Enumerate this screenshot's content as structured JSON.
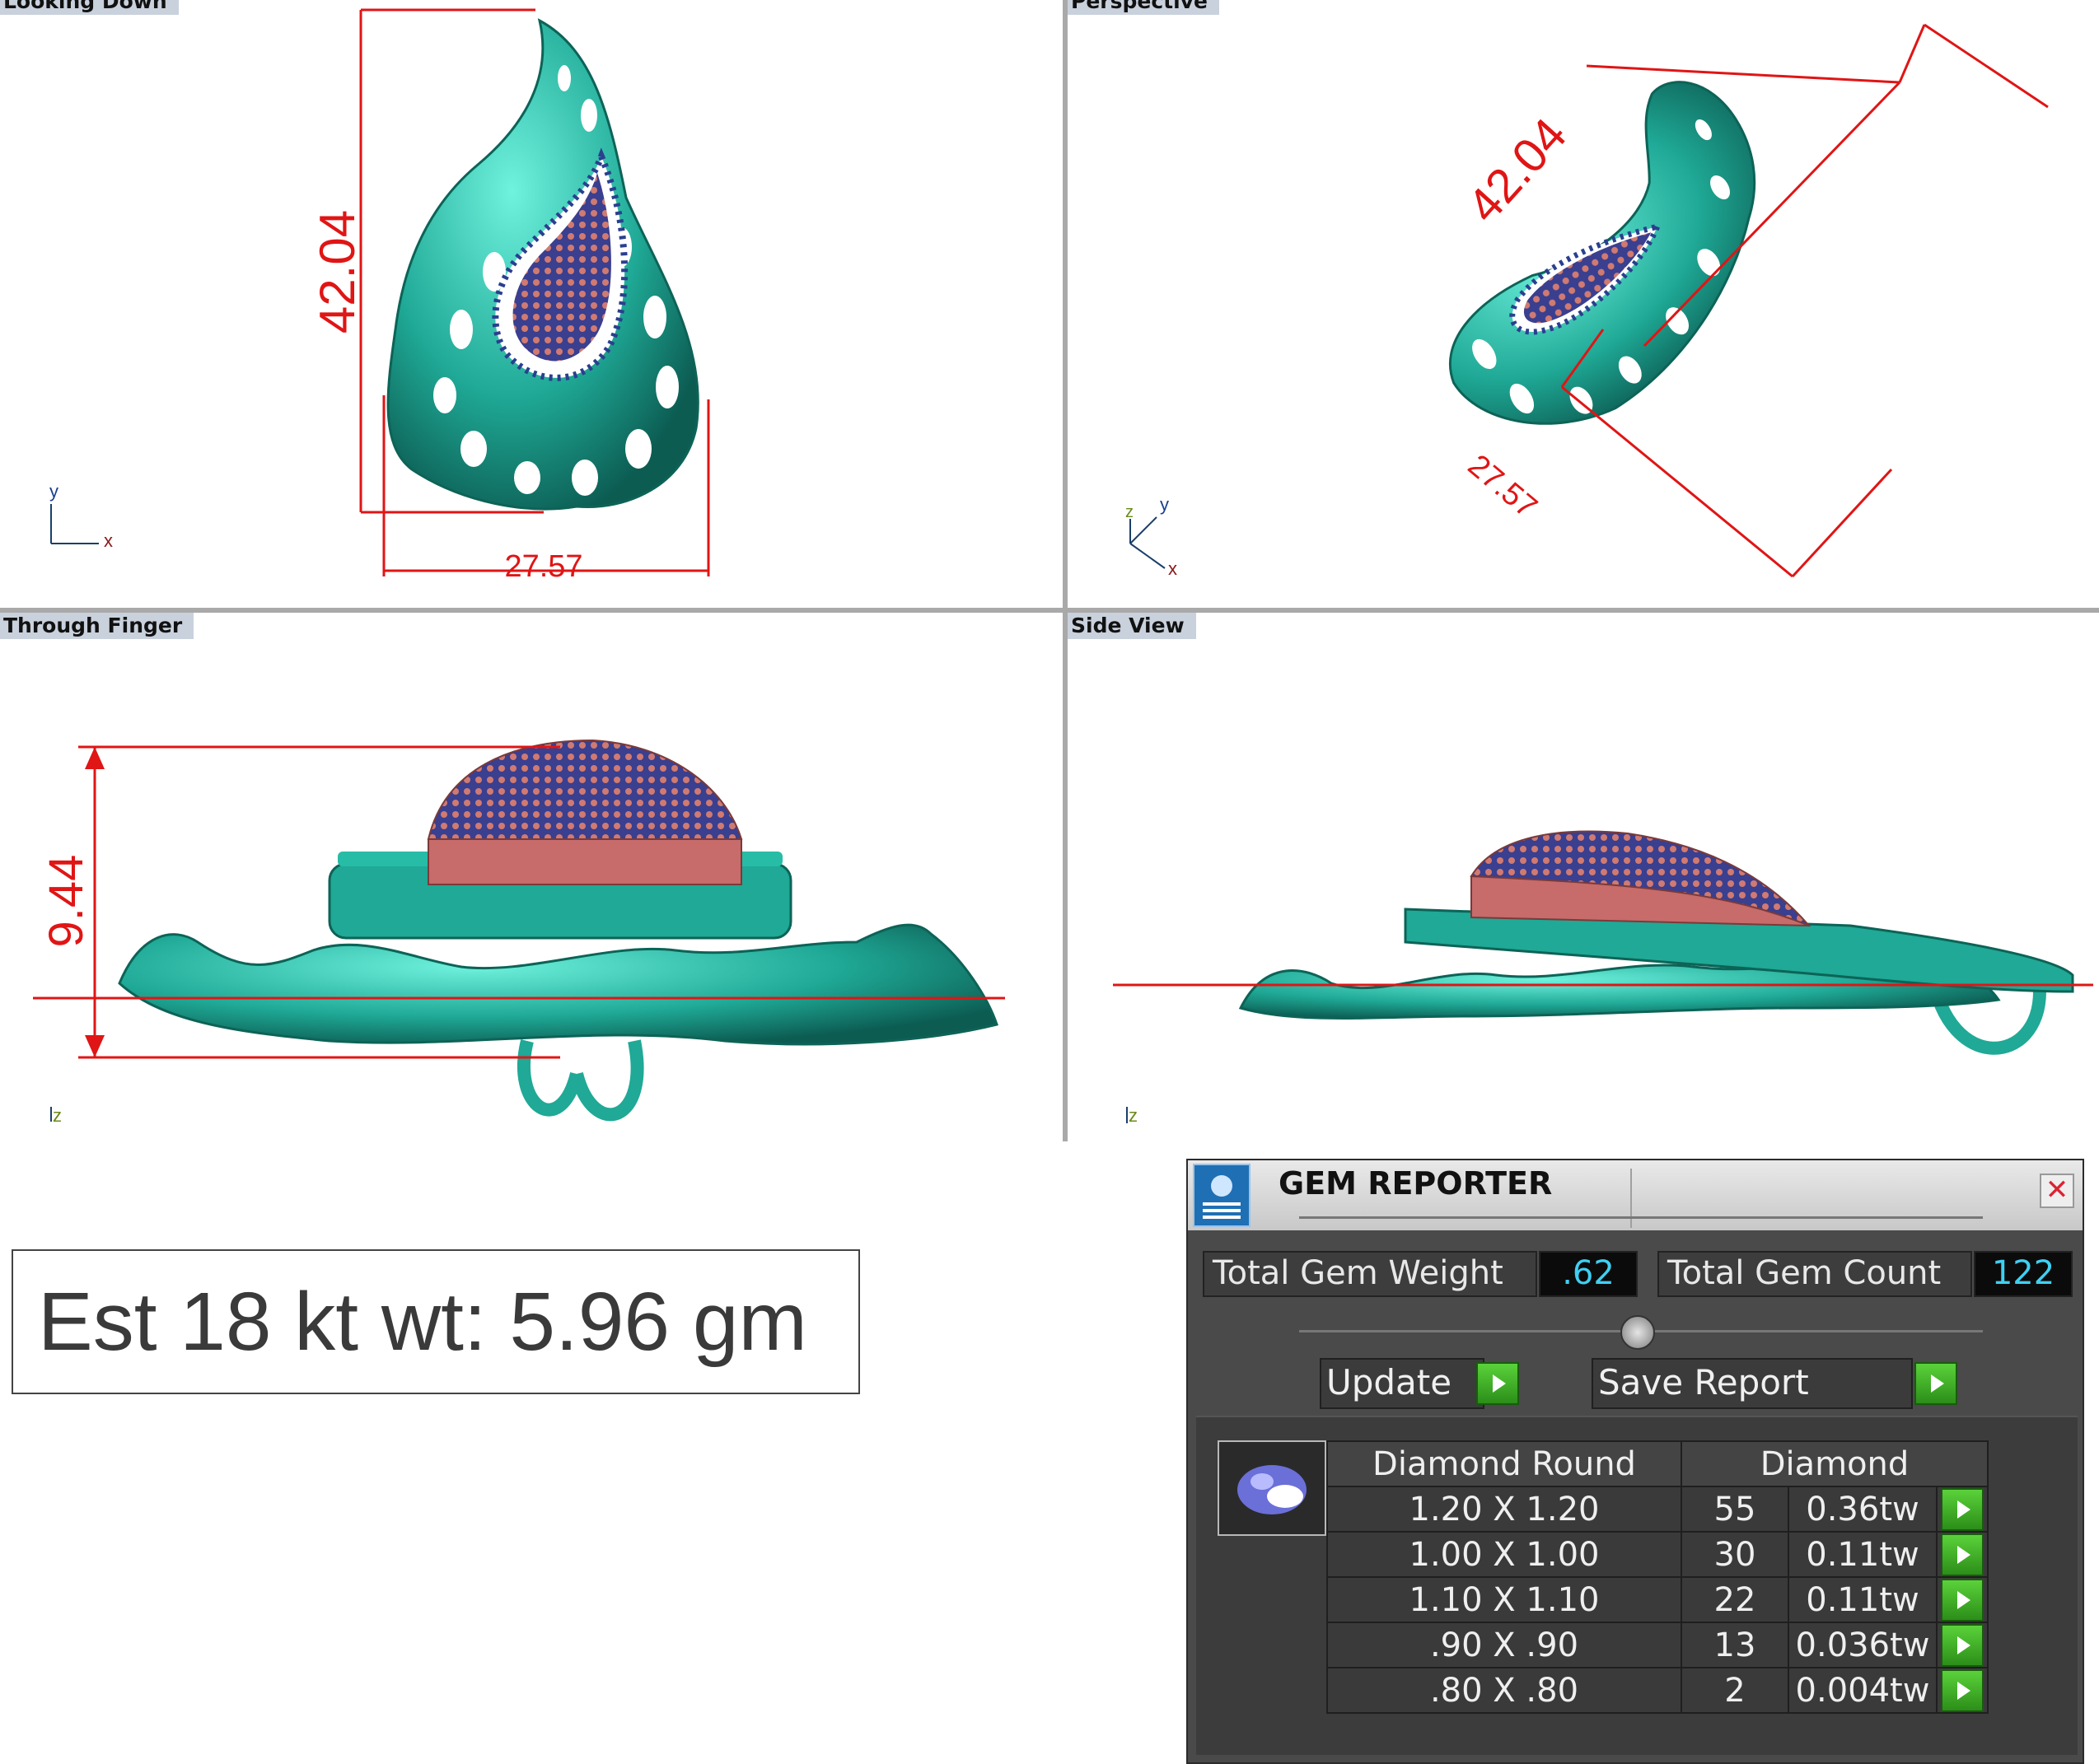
{
  "viewports": {
    "top_left": {
      "title": "Looking Down",
      "dim_vertical": "42.04",
      "dim_horizontal": "27.57",
      "axis_y": "y",
      "axis_x": "x"
    },
    "top_right": {
      "title": "Perspective",
      "dim_vertical": "42.04",
      "dim_horizontal": "27.57",
      "axis_z": "z",
      "axis_y": "y",
      "axis_x": "x"
    },
    "bottom_left": {
      "title": "Through Finger",
      "dim_height": "9.44",
      "axis_z": "z"
    },
    "bottom_right": {
      "title": "Side View",
      "axis_z": "z"
    }
  },
  "weight_box": {
    "text": "Est 18 kt wt: 5.96 gm"
  },
  "gem_reporter": {
    "title": "GEM REPORTER",
    "close": "✕",
    "total_gem_weight_label": "Total Gem Weight",
    "total_gem_weight_value": ".62",
    "total_gem_count_label": "Total Gem Count",
    "total_gem_count_value": "122",
    "update_label": "Update",
    "save_report_label": "Save Report",
    "columns": {
      "shape": "Diamond Round",
      "type": "Diamond"
    },
    "rows": [
      {
        "size": "1.20 X 1.20",
        "count": "55",
        "weight": "0.36tw"
      },
      {
        "size": "1.00 X 1.00",
        "count": "30",
        "weight": "0.11tw"
      },
      {
        "size": "1.10 X 1.10",
        "count": "22",
        "weight": "0.11tw"
      },
      {
        "size": ".90 X .90",
        "count": "13",
        "weight": "0.036tw"
      },
      {
        "size": ".80 X .80",
        "count": "2",
        "weight": "0.004tw"
      }
    ]
  },
  "colors": {
    "metal": "#1fa996",
    "stone_pink": "#c76b6b",
    "stone_blue": "#2a3f8f",
    "dimension": "#e01515"
  }
}
